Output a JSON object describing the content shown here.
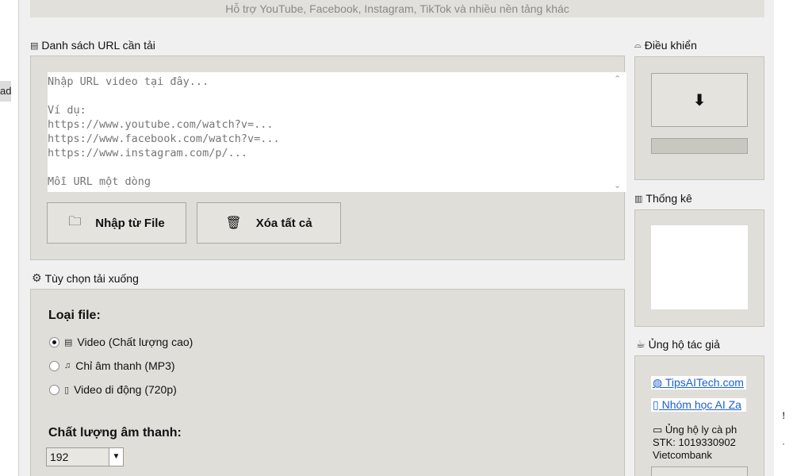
{
  "header": {
    "subtitle": "Hỗ trợ YouTube, Facebook, Instagram, TikTok và nhiều nền tảng khác"
  },
  "left_strip": {
    "glyph": "ad"
  },
  "url_section": {
    "label": "Danh sách URL cần tải",
    "icon": "clipboard-icon",
    "placeholder": "Nhập URL video tại đây...\n\nVí dụ:\nhttps://www.youtube.com/watch?v=...\nhttps://www.facebook.com/watch?v=...\nhttps://www.instagram.com/p/...\n\nMỗi URL một dòng",
    "import_button": "Nhập từ File",
    "clear_button": "Xóa tất cả"
  },
  "options_section": {
    "label": "Tùy chọn tải xuống",
    "file_type_title": "Loại file:",
    "file_types": [
      {
        "label": "Video (Chất lượng cao)",
        "selected": true,
        "icon": "film-icon"
      },
      {
        "label": "Chỉ âm thanh (MP3)",
        "selected": false,
        "icon": "music-icon"
      },
      {
        "label": "Video di động (720p)",
        "selected": false,
        "icon": "phone-icon"
      }
    ],
    "audio_quality_title": "Chất lượng âm thanh:",
    "audio_quality_value": "192"
  },
  "control_section": {
    "label": "Điều khiển",
    "download_glyph": "⬇",
    "progress": 0
  },
  "stats_section": {
    "label": "Thống kê"
  },
  "support_section": {
    "label": "Ủng hộ tác giả",
    "link1": "TipsAITech.com",
    "link2": "Nhóm học AI Za",
    "donate_text": "Ủng hộ ly cà ph",
    "account": "STK: 1019330902",
    "bank": "Vietcombank"
  },
  "colors": {
    "panel": "#dfded8",
    "link": "#1a5fd0",
    "window": "#f0f0f0"
  }
}
